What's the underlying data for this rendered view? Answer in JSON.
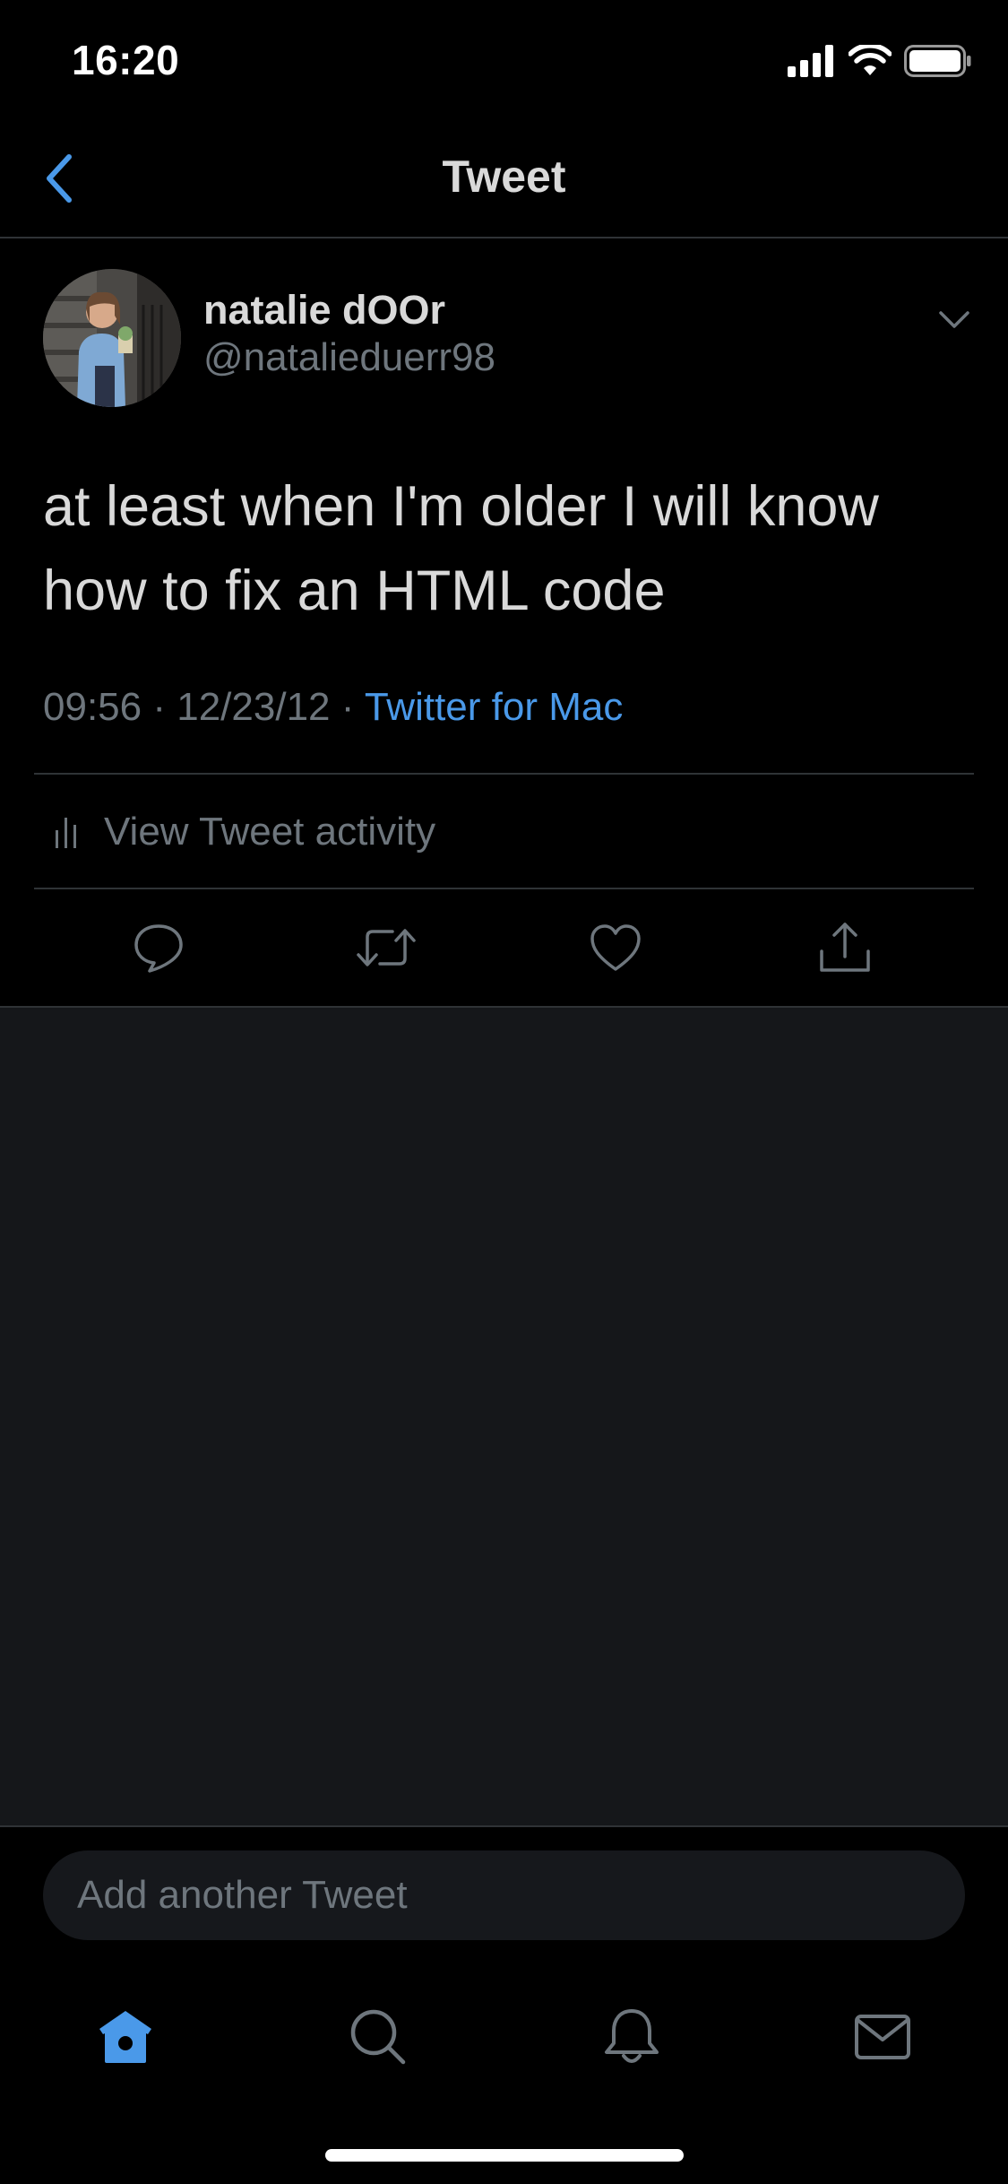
{
  "status_bar": {
    "time": "16:20",
    "icons": [
      "signal-icon",
      "wifi-icon",
      "battery-icon"
    ]
  },
  "nav": {
    "title": "Tweet",
    "back_icon": "chevron-left-icon"
  },
  "tweet": {
    "author": {
      "display_name": "natalie dOOr",
      "handle": "@natalieduerr98"
    },
    "text": "at least when I'm older I will know how to fix an HTML code",
    "time": "09:56",
    "date": "12/23/12",
    "separator": "·",
    "source": "Twitter for Mac",
    "activity_label": "View Tweet activity",
    "actions": [
      "reply-icon",
      "retweet-icon",
      "like-icon",
      "share-icon"
    ]
  },
  "compose": {
    "placeholder": "Add another Tweet"
  },
  "tab_bar": {
    "tabs": [
      "home-icon",
      "search-icon",
      "notifications-icon",
      "messages-icon"
    ],
    "active": "home-icon"
  },
  "colors": {
    "background": "#000000",
    "empty_area": "#15171a",
    "accent": "#4a99e9",
    "primary_text": "#d9d9d9",
    "secondary_text": "#6e767d",
    "divider": "#2f3336"
  }
}
